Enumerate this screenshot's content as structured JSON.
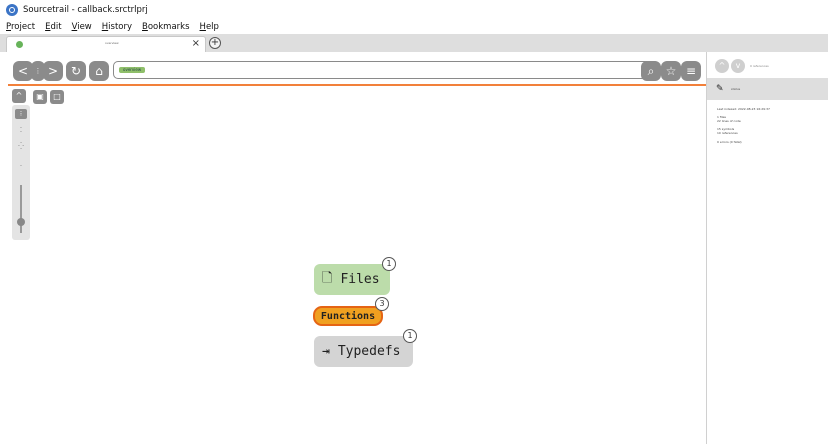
{
  "window": {
    "title": "Sourcetrail - callback.srctrlprj"
  },
  "menu": {
    "items": [
      {
        "label": "Project",
        "underline": "P",
        "rest": "roject"
      },
      {
        "label": "Edit",
        "underline": "E",
        "rest": "dit"
      },
      {
        "label": "View",
        "underline": "V",
        "rest": "iew"
      },
      {
        "label": "History",
        "underline": "H",
        "rest": "istory"
      },
      {
        "label": "Bookmarks",
        "underline": "B",
        "rest": "ookmarks"
      },
      {
        "label": "Help",
        "underline": "H",
        "rest": "elp"
      }
    ]
  },
  "tabs": {
    "active_label": "overview",
    "close_glyph": "×",
    "add_glyph": "+"
  },
  "toolbar": {
    "back_glyph": "<",
    "history_glyph": "⋮",
    "forward_glyph": ">",
    "refresh_glyph": "↻",
    "home_glyph": "⌂",
    "search_token": "overview",
    "search_glyph": "⌕",
    "bookmark_glyph": "☆",
    "bookmarks_menu_glyph": "≡"
  },
  "graph": {
    "collapse_glyph": "^",
    "nodes": {
      "files": {
        "label": "Files",
        "count": "1",
        "icon": "file-icon"
      },
      "functions": {
        "label": "Functions",
        "count": "3"
      },
      "typedefs": {
        "label": "Typedefs",
        "count": "1",
        "icon": "typedef-icon"
      }
    }
  },
  "right_panel": {
    "nav_prev": "^",
    "nav_next": "v",
    "nav_label": "0 references",
    "header_text": "status",
    "lines": [
      "Last indexed: 2022-08-23 16:29:37",
      "1 files",
      "22 lines of code",
      "15 symbols",
      "10 references",
      "0 errors (0 fatal)"
    ]
  },
  "colors": {
    "accent_orange": "#f2803a",
    "files_green": "#bcdcaa",
    "functions_fill": "#f0a020",
    "typedefs_gray": "#d4d4d4"
  }
}
